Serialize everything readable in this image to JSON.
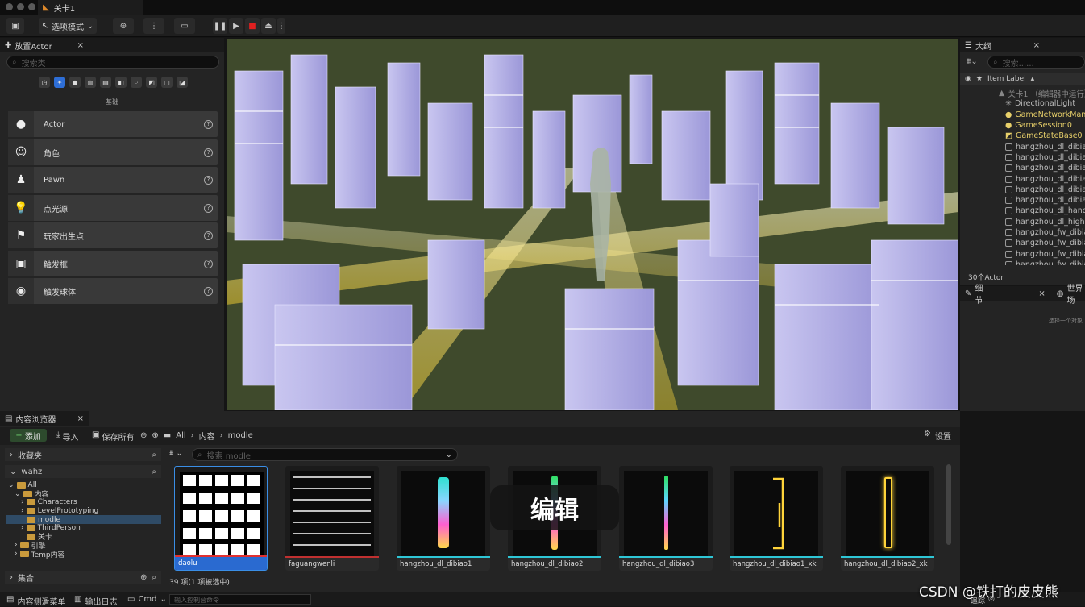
{
  "window": {
    "tab_title": "关卡1"
  },
  "toolbar": {
    "mode_label": "选项模式"
  },
  "place_actor": {
    "title": "放置Actor",
    "search_placeholder": "搜索类",
    "category_label": "基础",
    "items": [
      {
        "label": "Actor",
        "icon": "sphere-icon"
      },
      {
        "label": "角色",
        "icon": "character-icon"
      },
      {
        "label": "Pawn",
        "icon": "pawn-icon"
      },
      {
        "label": "点光源",
        "icon": "point-light-icon"
      },
      {
        "label": "玩家出生点",
        "icon": "player-start-icon"
      },
      {
        "label": "触发框",
        "icon": "trigger-box-icon"
      },
      {
        "label": "触发球体",
        "icon": "trigger-sphere-icon"
      }
    ]
  },
  "outliner": {
    "title": "大纲",
    "search_placeholder": "搜索......",
    "column_label": "Item Label",
    "root": "关卡1 （编辑器中运行）",
    "items": [
      "DirectionalLight",
      "GameNetworkManager",
      "GameSession0",
      "GameStateBase0",
      "hangzhou_dl_dibiao1",
      "hangzhou_dl_dibiao1",
      "hangzhou_dl_dibiao2",
      "hangzhou_dl_dibiao2",
      "hangzhou_dl_dibiao3",
      "hangzhou_dl_dibiao3",
      "hangzhou_dl_hangzhou",
      "hangzhou_dl_highway",
      "hangzhou_fw_dibiao1",
      "hangzhou_fw_dibiao1",
      "hangzhou_fw_dibiao2",
      "hangzhou_fw_dibiao2"
    ],
    "count": "30个Actor"
  },
  "details": {
    "title": "细节",
    "world_tab": "世界场",
    "hint": "选择一个对象"
  },
  "content_browser": {
    "title": "内容浏览器",
    "add": "添加",
    "import": "导入",
    "save_all": "保存所有",
    "breadcrumb": [
      "All",
      "内容",
      "modle"
    ],
    "settings": "设置",
    "favorites": "收藏夹",
    "project": "wahz",
    "search_placeholder": "搜索 modle",
    "tree": [
      "All",
      "内容",
      "Characters",
      "LevelPrototyping",
      "modle",
      "ThirdPerson",
      "关卡",
      "引擎",
      "Temp内容"
    ],
    "collections": "集合",
    "status": "39 项(1 项被选中)",
    "assets": [
      {
        "name": "daolu",
        "bar": "#e03030"
      },
      {
        "name": "faguangwenli",
        "bar": "#c03030"
      },
      {
        "name": "hangzhou_dl_dibiao1",
        "bar": "#2ec6d6"
      },
      {
        "name": "hangzhou_dl_dibiao2",
        "bar": "#2ec6d6"
      },
      {
        "name": "hangzhou_dl_dibiao3",
        "bar": "#2ec6d6"
      },
      {
        "name": "hangzhou_dl_dibiao1_xk",
        "bar": "#2ec6d6"
      },
      {
        "name": "hangzhou_dl_dibiao2_xk",
        "bar": "#2ec6d6"
      }
    ]
  },
  "overlay": {
    "edit_label": "编辑"
  },
  "statusbar": {
    "drawer": "内容侧滑菜单",
    "output_log": "输出日志",
    "cmd": "Cmd",
    "console_placeholder": "输入控制台命令",
    "trace": "追踪"
  },
  "watermark": "CSDN @铁打的皮皮熊"
}
